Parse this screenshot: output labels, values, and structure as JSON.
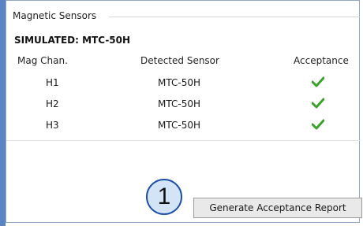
{
  "panel": {
    "title": "Magnetic Sensors",
    "simulated_heading": "SIMULATED: MTC-50H"
  },
  "table": {
    "headers": [
      "Mag Chan.",
      "Detected Sensor",
      "Acceptance"
    ],
    "rows": [
      {
        "channel": "H1",
        "sensor": "MTC-50H",
        "acceptance": "check-icon"
      },
      {
        "channel": "H2",
        "sensor": "MTC-50H",
        "acceptance": "check-icon"
      },
      {
        "channel": "H3",
        "sensor": "MTC-50H",
        "acceptance": "check-icon"
      }
    ]
  },
  "callout": {
    "number": "1"
  },
  "actions": {
    "generate_label": "Generate Acceptance Report"
  },
  "colors": {
    "accent_blue": "#1c4fa5",
    "check_green": "#3aa12b",
    "callout_fill": "#d4e4f7"
  }
}
